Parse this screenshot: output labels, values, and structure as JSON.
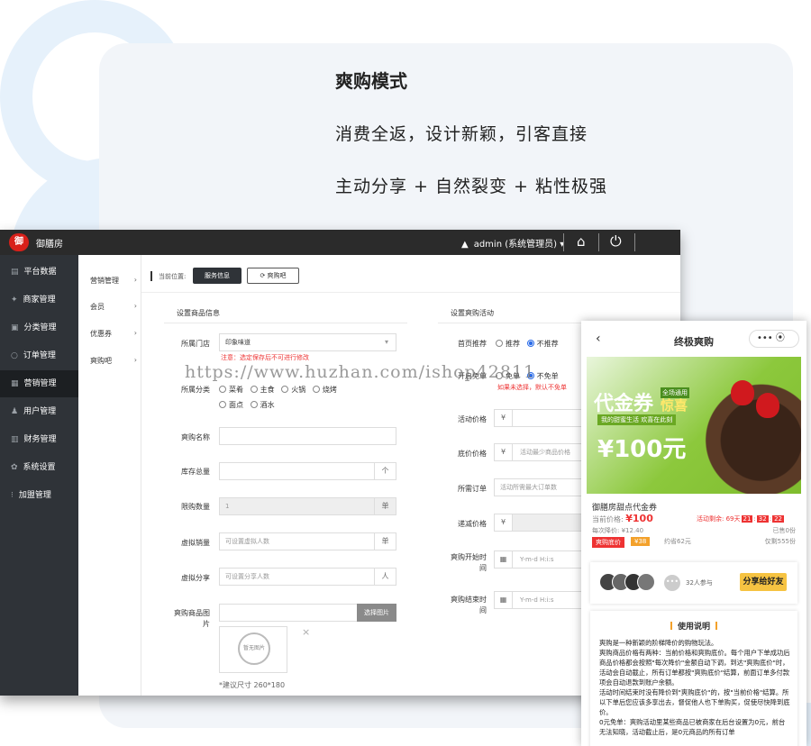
{
  "promo": {
    "headline": "爽购模式",
    "line1": "消费全返，设计新颖，引客直接",
    "line2": "主动分享 + 自然裂变 + 粘性极强"
  },
  "topbar": {
    "logo_text": "御",
    "brand": "御膳房",
    "user_icon": "▲",
    "user": "admin (系统管理员) ▾",
    "home_icon": "⌂",
    "power_icon": "⏻"
  },
  "sidebar": {
    "items": [
      {
        "icon": "▤",
        "label": "平台数据"
      },
      {
        "icon": "✦",
        "label": "商家管理"
      },
      {
        "icon": "▣",
        "label": "分类管理"
      },
      {
        "icon": "○",
        "label": "订单管理"
      },
      {
        "icon": "▦",
        "label": "营销管理"
      },
      {
        "icon": "♟",
        "label": "用户管理"
      },
      {
        "icon": "▥",
        "label": "财务管理"
      },
      {
        "icon": "✿",
        "label": "系统设置"
      },
      {
        "icon": "⁝",
        "label": "加盟管理"
      }
    ]
  },
  "subnav": {
    "items": [
      {
        "label": "营销管理",
        "arrow": "›"
      },
      {
        "label": "会员",
        "arrow": "›"
      },
      {
        "label": "优惠券",
        "arrow": "›"
      },
      {
        "label": "爽购吧",
        "arrow": "›"
      }
    ]
  },
  "crumb": {
    "label": "当前位置:",
    "tab_active": "服务信息",
    "tab_normal": "⟳ 爽购吧"
  },
  "left_form": {
    "title": "设置商品信息",
    "store_label": "所属门店",
    "store_value": "印象味道",
    "store_caret": "▾",
    "store_note": "注意：选定保存后不可进行修改",
    "category_label": "所属分类",
    "category_row1": [
      "菜肴",
      "主食",
      "火锅",
      "烧烤"
    ],
    "category_row2": [
      "面点",
      "酒水"
    ],
    "name_label": "爽购名称",
    "stock_label": "库存总量",
    "stock_unit": "个",
    "limit_label": "限购数量",
    "limit_value": "1",
    "limit_unit": "单",
    "vsales_label": "虚拟销量",
    "vsales_placeholder": "可设置虚拟人数",
    "vsales_unit": "单",
    "vshare_label": "虚拟分享",
    "vshare_placeholder": "可设置分享人数",
    "vshare_unit": "人",
    "image_label": "爽购商品图",
    "image_label2": "片",
    "upload_button": "选择图片",
    "no_image": "暂无图片",
    "remove_icon": "×",
    "size_hint": "*建议尺寸 260*180"
  },
  "right_form": {
    "title": "设置爽购活动",
    "home_label": "首页推荐",
    "home_options": [
      "推荐",
      "不推荐"
    ],
    "free_label": "开启免单",
    "free_options": [
      "免单",
      "不免单"
    ],
    "free_note": "如果未选择，默认不免单",
    "price_label": "活动价格",
    "currency": "¥",
    "floor_label": "底价价格",
    "floor_placeholder": "活动最少商品价格",
    "orders_label": "所需订单",
    "orders_placeholder": "活动所需最大订单数",
    "reduce_label": "递减价格",
    "start_label": "爽购开始时",
    "start_label2": "间",
    "end_label": "爽购结束时",
    "end_label2": "间",
    "date_icon": "▦",
    "date_placeholder": "Y-m-d H:i:s"
  },
  "watermark": "https://www.huzhan.com/ishop42811",
  "phone": {
    "back_icon": "‹",
    "title": "终极爽购",
    "caps_icons": "••• ⦿",
    "banner_voucher": "代金券",
    "banner_sub": "全场通用",
    "banner_jing": "惊喜",
    "banner_tag": "我的甜蜜生活 欢喜在此刻",
    "banner_price": "¥100元",
    "product_name": "御膳房甜点代金券",
    "now_label": "当前价格:",
    "now_price": "¥100",
    "remain_label": "活动剩余: 69天",
    "countdown": [
      "21",
      "32",
      "22"
    ],
    "next_drop": "每次降价: ¥12.40",
    "sold": "已售0份",
    "floor_tag": "爽购底价",
    "floor_price": "¥38",
    "save": "约省62元",
    "stock": "仅剩555份",
    "more_icon": "•••",
    "participants": "32人参与",
    "share_button": "分享给好友",
    "desc_title": "使用说明",
    "desc_lines": [
      "爽购是一种新颖的阶梯降价的购物玩法。",
      "爽购商品价格有两种：当前价格和爽购底价。每个用户下单成功后商品价格都会按照\"每次降价\"金额自动下调，到达\"爽购底价\"时，活动会自动截止，所有订单都按\"爽购底价\"结算，前面订单多付款项会自动退款到账户余额。",
      "活动时间结束时没有降价到\"爽购底价\"的，按\"当前价格\"结算。所以下单后您应该多享出去，督促他人也下单购买，促使尽快降到底价。",
      "0元免单：爽购活动里某些商品已被商家在后台设置为0元，前台无法知晓，活动截止后，是0元商品的所有订单"
    ]
  }
}
